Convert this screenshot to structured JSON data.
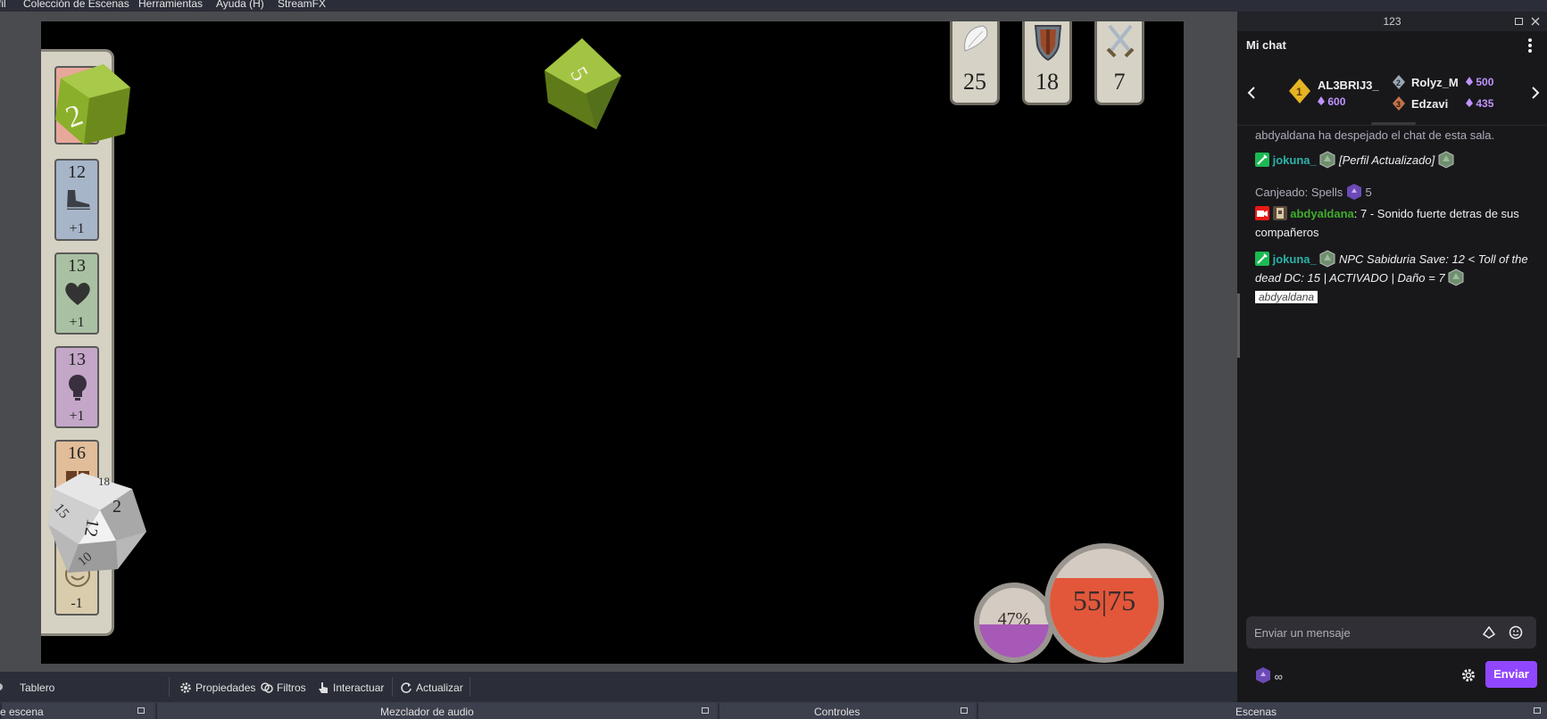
{
  "menu": {
    "items": [
      "fil",
      "Colección de Escenas",
      "Herramientas",
      "Ayuda (H)",
      "StreamFX"
    ]
  },
  "sheet": {
    "stats": [
      {
        "value": "12",
        "modifier": "+1",
        "icon": "boot-icon",
        "color": "#a7b5c9"
      },
      {
        "value": "13",
        "modifier": "+1",
        "icon": "heart-icon",
        "color": "#a9c1a2"
      },
      {
        "value": "13",
        "modifier": "+1",
        "icon": "lightbulb-icon",
        "color": "#c4a7c8"
      },
      {
        "value": "16",
        "modifier": "",
        "icon": "book-icon",
        "color": "#e1bd9a"
      },
      {
        "value": "",
        "modifier": "-1",
        "icon": "smile-icon",
        "color": "#d9ccad"
      }
    ],
    "dice": {
      "d6_top": "2",
      "d8": "5",
      "d20_faces": [
        "18",
        "2",
        "15",
        "12",
        "10"
      ]
    }
  },
  "top_cards": [
    {
      "icon": "wing-icon",
      "value": "25"
    },
    {
      "icon": "shield-icon",
      "value": "18"
    },
    {
      "icon": "crossed-swords-icon",
      "value": "7"
    }
  ],
  "orbs": {
    "mana": {
      "text": "47%",
      "fill_percent": 47,
      "color": "#a659b6"
    },
    "health": {
      "text": "55|75",
      "current": 55,
      "max": 75,
      "color": "#e2573a"
    }
  },
  "toolbar": {
    "source_name": "Tablero",
    "properties": "Propiedades",
    "filters": "Filtros",
    "interact": "Interactuar",
    "refresh": "Actualizar"
  },
  "docks": {
    "scene_source": "e escena",
    "audio_mixer": "Mezclador de audio",
    "controls": "Controles",
    "scenes": "Escenas"
  },
  "chat": {
    "window_title": "123",
    "title": "Mi chat",
    "leaderboard": [
      {
        "rank": "1",
        "name": "AL3BRIJ3_",
        "points": "600"
      },
      {
        "rank": "2",
        "name": "Rolyz_M",
        "points": "500"
      },
      {
        "rank": "3",
        "name": "Edzavi",
        "points": "435"
      }
    ],
    "messages": {
      "cleared": "abdyaldana ha despejado el chat de esta sala.",
      "m1_user": "jokuna_",
      "m1_text": "[Perfil Actualizado]",
      "redeem_label": "Canjeado: Spells",
      "redeem_cost": "5",
      "m2_user": "abdyaldana",
      "m2_text": ": 7 - Sonido fuerte detras de sus compañeros",
      "m3_user": "jokuna_",
      "m3_text": "NPC Sabiduria Save: 12 < Toll of the dead DC: 15 | ACTIVADO | Daño = 7",
      "m3_mention": "abdyaldana"
    },
    "input_placeholder": "Enviar un mensaje",
    "points_balance": "∞",
    "send_label": "Enviar",
    "accent": "#9147ff"
  }
}
